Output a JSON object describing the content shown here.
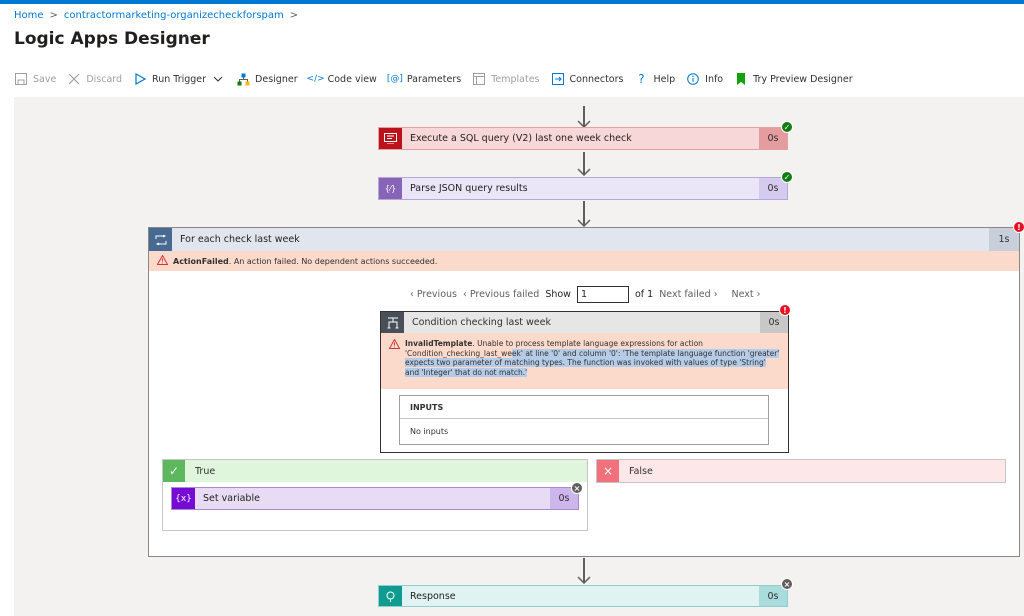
{
  "breadcrumb": {
    "home": "Home",
    "sep1": ">",
    "resource": "contractormarketing-organizecheckforspam",
    "sep2": ">"
  },
  "page": {
    "title": "Logic Apps Designer",
    "more": "···"
  },
  "toolbar": {
    "save": "Save",
    "discard": "Discard",
    "run_trigger": "Run Trigger",
    "designer": "Designer",
    "code_view": "Code view",
    "parameters": "Parameters",
    "templates": "Templates",
    "connectors": "Connectors",
    "help": "Help",
    "info": "Info",
    "preview": "Try Preview Designer"
  },
  "steps": {
    "sql": {
      "title": "Execute a SQL query (V2) last one week check",
      "time": "0s",
      "color": "#ba141a"
    },
    "parse": {
      "title": "Parse JSON query results",
      "time": "0s",
      "color": "#8764b8"
    },
    "foreach": {
      "title": "For each check last week",
      "time": "1s",
      "error_code": "ActionFailed",
      "error_text": ". An action failed. No dependent actions succeeded."
    },
    "pager": {
      "previous": "Previous",
      "previous_failed": "Previous failed",
      "show": "Show",
      "value": "1",
      "of": "of 1",
      "next_failed": "Next failed",
      "next": "Next"
    },
    "condition": {
      "title": "Condition checking last week",
      "time": "0s",
      "error_code": "InvalidTemplate",
      "error_line1": ". Unable to process template language expressions for action",
      "error_line2a": "'Condition_checking_last_we",
      "error_line2b": "ek' at line '0' and column '0': 'The template language function 'greater'",
      "error_line3": "expects two parameter of matching types. The function was invoked with values of type 'String'",
      "error_line4": "and 'Integer' that do not match.'",
      "inputs_label": "INPUTS",
      "inputs_value": "No inputs"
    },
    "true_branch": {
      "label": "True",
      "action": "Set variable",
      "time": "0s"
    },
    "false_branch": {
      "label": "False"
    },
    "response": {
      "title": "Response",
      "time": "0s"
    }
  }
}
